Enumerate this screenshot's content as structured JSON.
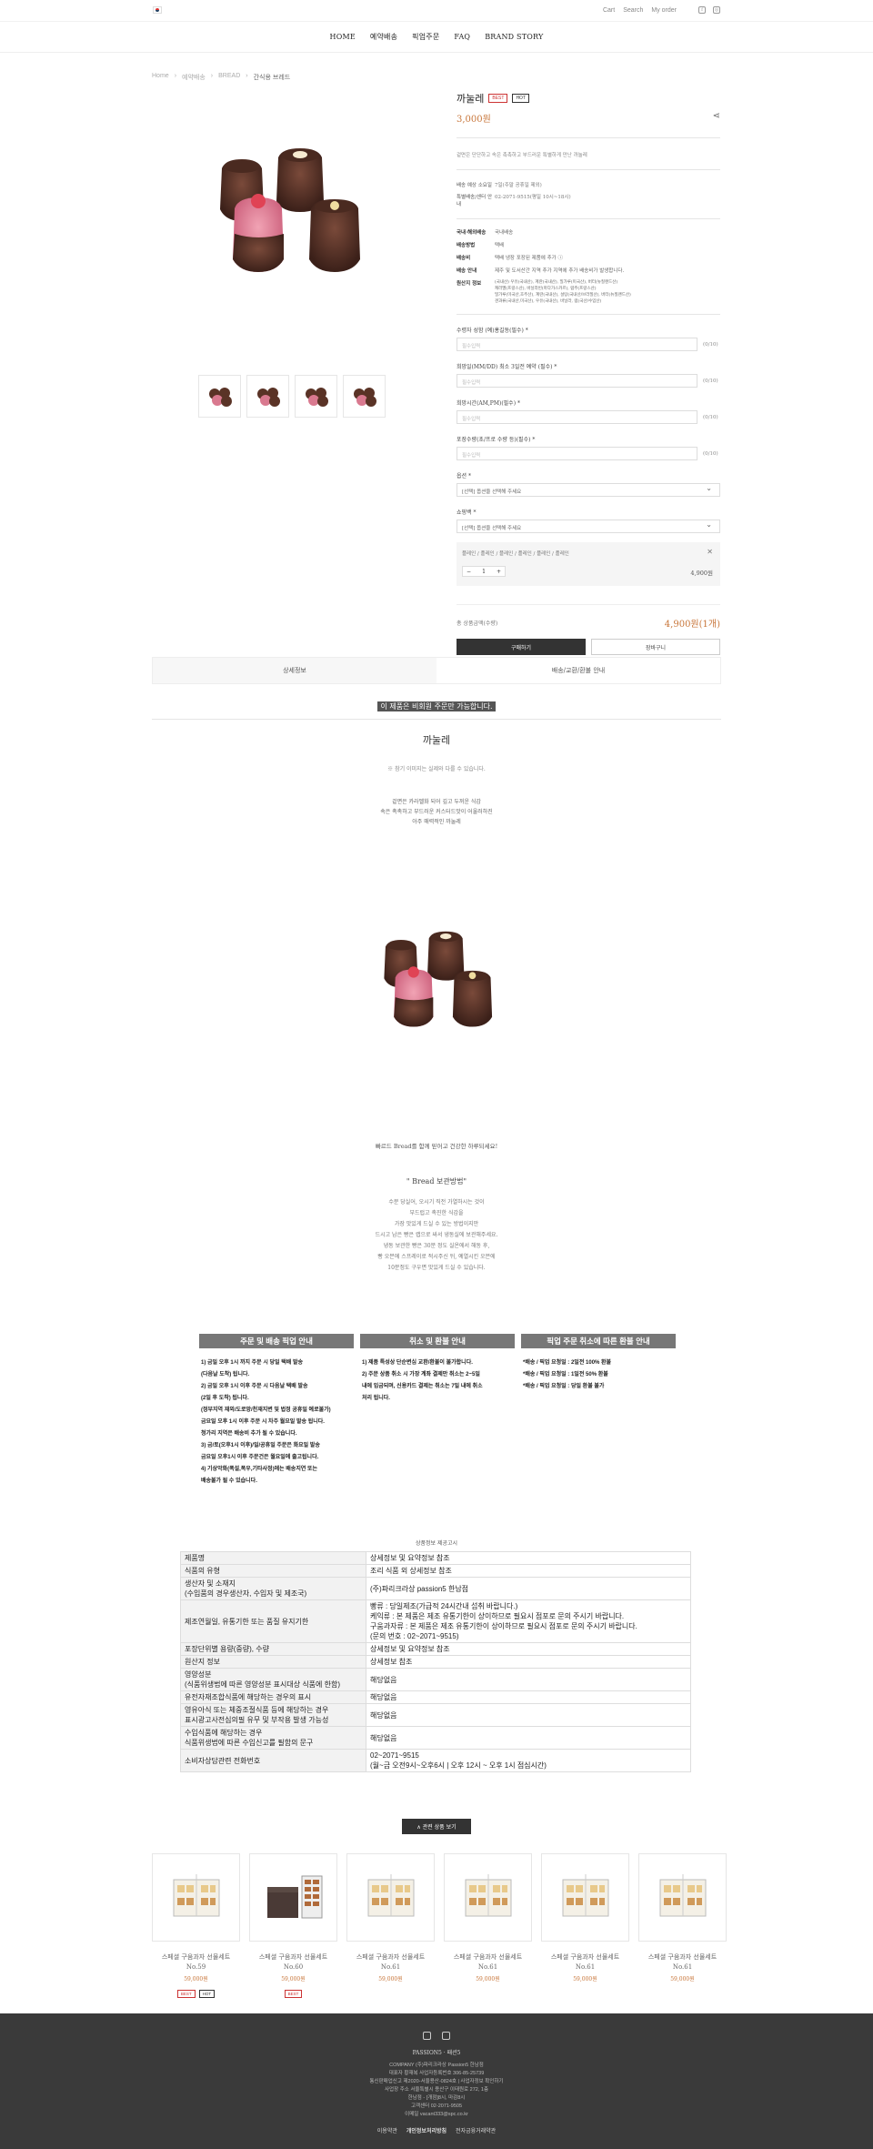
{
  "topbar": {
    "links": [
      "Cart",
      "Search",
      "My order"
    ]
  },
  "nav": [
    "HOME",
    "예약배송",
    "픽업주문",
    "FAQ",
    "BRAND STORY"
  ],
  "breadcrumb": [
    "Home",
    "예약배송",
    "BREAD",
    "간식용 브레드"
  ],
  "product": {
    "name": "까눌레",
    "badges": [
      "BEST",
      "HOT"
    ],
    "price": "3,000원",
    "summary": "겉면은 단단하고 속은 촉촉하고 부드러운 특별하게 만난 까눌레",
    "specs": [
      {
        "k": "배송 예상 소요일",
        "v": "7일(주말 공휴일 제외)"
      },
      {
        "k": "특별배송/센터 안내",
        "v": "02-2071-9515(평일 10시~18시)"
      }
    ],
    "delivery": [
      {
        "k": "국내·해외배송",
        "v": "국내배송"
      },
      {
        "k": "배송방법",
        "v": "택배"
      },
      {
        "k": "배송비",
        "v": "택배 냉장 포장된 제품에 추가 ⓘ"
      },
      {
        "k": "배송 안내",
        "v": "제주 및 도서산간 지역 추가 지역에 추가 배송비가 발생합니다."
      },
      {
        "k": "원산지 정보",
        "v": "(국내산) 우유(국내산), 계란(국내산), 밀가루(미국산), 버터(뉴질랜드산)\n캐러멜(프랑스산), 바닐라빈(마다가스카르), 럼주(프랑스산)\n밀가루(미국산,호주산), 계란(국내산), 설탕(국내산/브라질산), 버터(뉴질랜드산)\n견과류(국내산,미국산), 우유(국내산), 바닐라, 럼(국산/수입산)"
      }
    ],
    "fields": [
      {
        "label": "수령자 성함 (예)홍길동(필수) *",
        "placeholder": "필수입력",
        "unit": "(0/10)"
      },
      {
        "label": "희망일(MM/DD) 최소 3일전 예약 (필수) *",
        "placeholder": "필수입력",
        "unit": "(0/10)"
      },
      {
        "label": "희망시간(AM,PM)(필수) *",
        "placeholder": "필수입력",
        "unit": "(0/10)"
      },
      {
        "label": "포장수량(초/프로 수량 등)(필수) *",
        "placeholder": "필수입력",
        "unit": "(0/10)"
      }
    ],
    "selects": [
      {
        "label": "옵션 *",
        "value": "[선택] 옵션을 선택해 주세요"
      },
      {
        "label": "쇼핑백 *",
        "value": "[선택] 옵션을 선택해 주세요"
      }
    ],
    "selected_option": "플레인 / 플레인 / 플레인 / 플레인 / 플레인 / 플레인",
    "qty": "1",
    "sub_price": "4,900원",
    "total_label": "총 상품금액(수량)",
    "total_value": "4,900원(1개)",
    "buy": "구매하기",
    "cart": "장바구니"
  },
  "tabs": [
    "상세정보",
    "배송/교환/환불 안내"
  ],
  "detail": {
    "notice": "이 제품은 비회원 주문만 가능합니다.",
    "title": "까눌레",
    "note": "※ 참기 이미지는 실제와 다를 수 있습니다.",
    "copy": [
      "겉면은 카라멜화 되어 깊고 두꺼운 식감",
      "속은 촉촉하고 부드러운 커스터드맛이 어울러하진",
      "아주 매력적인 까눌레"
    ],
    "copy2": "빠르드 Bread를 함께 믿어고 건강한 하루되세요!",
    "subtitle": "\" Bread 보관방법\"",
    "text": [
      "수분 당실어, 오시기 직전 가열하시는 것이",
      "부드럽고 촉진한 식감을",
      "가장 맛있게 드실 수 있는 방법이지만",
      "드시고 남은 빵은 랩으로 싸서 냉동실에 보관해주세요.",
      "냉동 보관한 빵은 30분 정도 실온에서 해동 후,",
      "빵 오븐에 스프레이로 적시주신 뒤, 예열시킨 오븐에",
      "10분정도 구우면 맛있게 드실 수 있습니다."
    ]
  },
  "boxes": [
    {
      "title": "주문 및 배송 픽업 안내",
      "lines": [
        "1) 금일 오후 1시 까지 주문 시 당일 택배 발송",
        "   (다음날 도착) 됩니다.",
        "2) 금일 오후 1시 이후 주문 시 다음날 택배 발송",
        "   (2일 후 도착) 됩니다.",
        "(정부지역 재외/도로망/천재지변 및 법정 공휴일 예로불가)",
        "금요일 오후 1시 이후 주문 시 차주 월요일 발송 됩니다.",
        "청가리 지역은 배송비 추가 될 수 있습니다.",
        "3) 금/토(오후1시 이후)/일/공휴일 주문은 화요일 발송",
        "금요일 오후1시 이후 주문건은 월요일에 출고됩니다.",
        "4) 기상악화(폭설,폭우,기타사정)에는 배송지연 또는",
        "배송불가 될 수 있습니다."
      ]
    },
    {
      "title": "취소 및 환불 안내",
      "lines": [
        "1) 제품 특성상 단순변심 교환/환불이 불가합니다.",
        "2) 주문 상품 취소 시 가장 계좌 결제만 취소는 2~5일",
        "내에 입금되며, 신용카드 결제는 취소는 7일 내에 취소",
        "처리 됩니다."
      ]
    },
    {
      "title": "픽업 주문 취소에 따른 환불 안내",
      "lines": [
        "*배송 / 픽업 요청일 : 2일전 100% 환불",
        "*배송 / 픽업 요청일 : 1일전 50% 환불",
        "*배송 / 픽업 요청일 : 당일 환불 불가"
      ]
    }
  ],
  "spec_table": {
    "title": "상품정보 제공고시",
    "rows": [
      {
        "k": "제품명",
        "v": "상세정보 및 요약정보 참조"
      },
      {
        "k": "식품의 유형",
        "v": "조리 식품 외 상세정보 참조"
      },
      {
        "k": "생산자 및 소재지\n(수입품의 경우생산자, 수입자 및 제조국)",
        "v": "(주)파리크라상 passion5 한남점"
      },
      {
        "k": "제조연월일, 유통기한 또는 품질 유지기한",
        "v": "빵류 : 당일제조(가급적 24시간내 섭취 바랍니다.)\n케익류 : 본 제품은 제조 유통기한이 상이하므로 필요시 점포로 문의 주시기 바랍니다.\n구움과자류 : 본 제품은 제조 유통기한이 상이하므로 필요시 점포로 문의 주시기 바랍니다.\n(문의 번호 : 02~2071~9515)"
      },
      {
        "k": "포장단위별 용량(중량), 수량",
        "v": "상세정보 및 요약정보 참조"
      },
      {
        "k": "원산지 정보",
        "v": "상세정보 참조"
      },
      {
        "k": "영양성분\n(식품위생법에 따른 영양성분 표시대상 식품에 한함)",
        "v": "해당없음"
      },
      {
        "k": "유전자재조합식품에 해당하는 경우의 표시",
        "v": "해당없음"
      },
      {
        "k": "영유아식 또는 체중조절식품 등에 해당하는 경우\n표시광고사전심의필 유무 및 부작용 발생 가능성",
        "v": "해당없음"
      },
      {
        "k": "수입식품에 해당하는 경우\n식품위생법에 따른 수입신고를 필함의 문구",
        "v": "해당없음"
      },
      {
        "k": "소비자상담관련 전화번호",
        "v": "02~2071~9515\n(월~금 오전9시~오후6시 |  오후 12시 ~ 오후 1시 점심시간)"
      }
    ]
  },
  "related_button": "∧ 관련 상품 보기",
  "related": [
    {
      "name": "스페셜 구움과자 선물세트\nNo.59",
      "price": "59,000원",
      "badges": [
        "BEST",
        "HOT"
      ]
    },
    {
      "name": "스페셜 구움과자 선물세트\nNo.60",
      "price": "59,000원",
      "badges": [
        "BEST"
      ]
    },
    {
      "name": "스페셜 구움과자 선물세트\nNo.61",
      "price": "59,000원",
      "badges": []
    },
    {
      "name": "스페셜 구움과자 선물세트\nNo.61",
      "price": "59,000원",
      "badges": []
    },
    {
      "name": "스페셜 구움과자 선물세트\nNo.61",
      "price": "59,000원",
      "badges": []
    },
    {
      "name": "스페셜 구움과자 선물세트\nNo.61",
      "price": "59,000원",
      "badges": []
    }
  ],
  "footer": {
    "brand": "PASSION5 · 패션5",
    "lines": [
      "COMPANY (주)파리크라상 Passion5 한남점",
      "대표자 황재복 사업자등록번호 306-85-25739",
      "통신판매업신고 제2020-서울용산-0824호 | 사업자정보 확인하기",
      "사업장 주소 서울특별시 용산구 이태원로 272, 1층",
      "한남점 - [개점]8시, 마감8시",
      "고객센터 02-2071-9505",
      "이메일 vacant333@spc.co.kr"
    ],
    "links": [
      "이용약관",
      "개인정보처리방침",
      "전자금융거래약관"
    ]
  },
  "colors": {
    "accent": "#c8763a",
    "dark": "#333333",
    "footer": "#3a3a3a"
  }
}
